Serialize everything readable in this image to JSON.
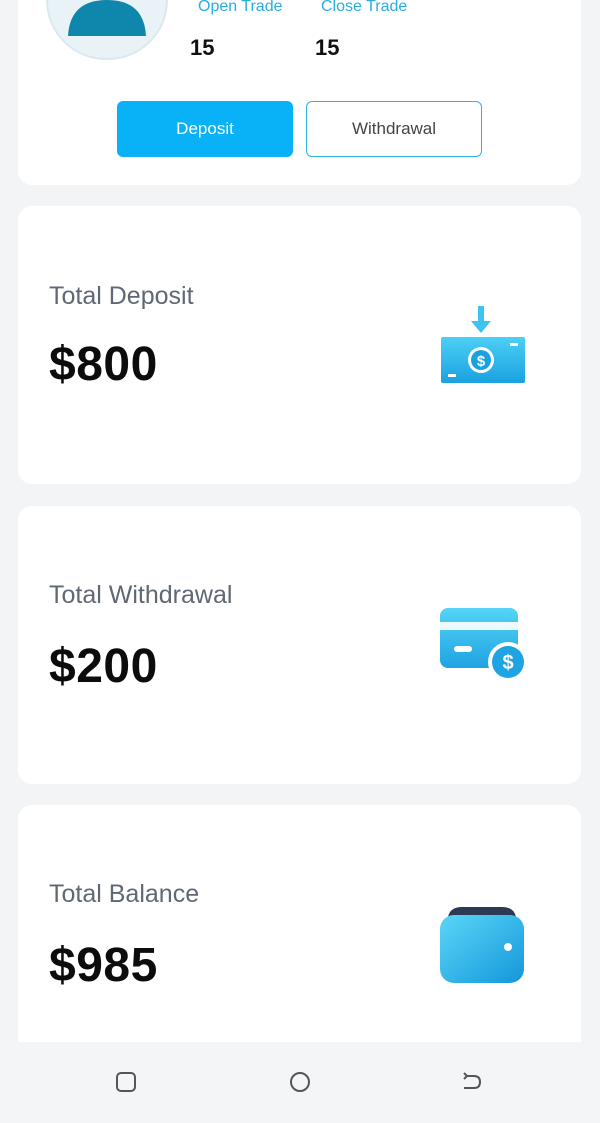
{
  "profile": {
    "open_trade_label": "Open Trade",
    "open_trade_value": "15",
    "close_trade_label": "Close Trade",
    "close_trade_value": "15",
    "deposit_button": "Deposit",
    "withdrawal_button": "Withdrawal"
  },
  "cards": [
    {
      "title": "Total Deposit",
      "currency": "$",
      "amount": "800",
      "icon": "deposit-money-icon"
    },
    {
      "title": "Total Withdrawal",
      "currency": "$",
      "amount": "200",
      "icon": "card-payment-icon"
    },
    {
      "title": "Total Balance",
      "currency": "$",
      "amount": "985",
      "icon": "wallet-icon"
    }
  ],
  "nav": {
    "recent_icon": "recent-apps-icon",
    "home_icon": "home-icon",
    "back_icon": "back-icon"
  },
  "colors": {
    "accent": "#09b1f7",
    "label_blue": "#29aee0",
    "background": "#f3f4f6"
  }
}
